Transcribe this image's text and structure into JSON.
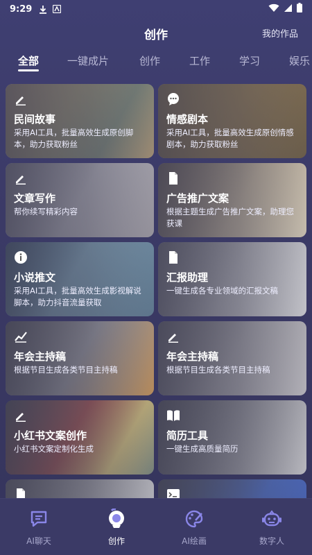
{
  "status_bar": {
    "time": "9:29"
  },
  "header": {
    "title": "创作",
    "my_works": "我的作品"
  },
  "tabs": [
    {
      "label": "全部",
      "active": true
    },
    {
      "label": "一键成片"
    },
    {
      "label": "创作"
    },
    {
      "label": "工作"
    },
    {
      "label": "学习"
    },
    {
      "label": "娱乐"
    }
  ],
  "cards": [
    {
      "title": "民间故事",
      "desc": "采用AI工具，批量高效生成原创脚本，助力获取粉丝",
      "icon": "pencil-icon"
    },
    {
      "title": "情感剧本",
      "desc": "采用AI工具，批量高效生成原创情感剧本，助力获取粉丝",
      "icon": "chat-bubble-icon"
    },
    {
      "title": "文章写作",
      "desc": "帮你续写精彩内容",
      "icon": "pencil-icon"
    },
    {
      "title": "广告推广文案",
      "desc": "根据主题生成广告推广文案，助理您获课",
      "icon": "document-icon"
    },
    {
      "title": "小说推文",
      "desc": "采用AI工具，批量高效生成影视解说脚本，助力抖音流量获取",
      "icon": "info-icon"
    },
    {
      "title": "汇报助理",
      "desc": "一键生成各专业领域的汇报文稿",
      "icon": "document-icon"
    },
    {
      "title": "年会主持稿",
      "desc": "根据节目生成各类节目主持稿",
      "icon": "trend-chart-icon"
    },
    {
      "title": "年会主持稿",
      "desc": "根据节目生成各类节目主持稿",
      "icon": "pencil-icon"
    },
    {
      "title": "小红书文案创作",
      "desc": "小红书文案定制化生成",
      "icon": "pencil-icon"
    },
    {
      "title": "简历工具",
      "desc": "一键生成高质量简历",
      "icon": "book-icon"
    },
    {
      "title": "",
      "desc": "",
      "icon": "document-icon"
    },
    {
      "title": "",
      "desc": "",
      "icon": "terminal-icon"
    }
  ],
  "bottom_nav": [
    {
      "label": "AI聊天",
      "icon": "chat-icon"
    },
    {
      "label": "创作",
      "icon": "create-icon",
      "active": true
    },
    {
      "label": "AI绘画",
      "icon": "palette-icon"
    },
    {
      "label": "数字人",
      "icon": "robot-icon"
    }
  ],
  "colors": {
    "background": "#3b3a66",
    "accent": "#8a86e8",
    "text": "#ffffff"
  }
}
